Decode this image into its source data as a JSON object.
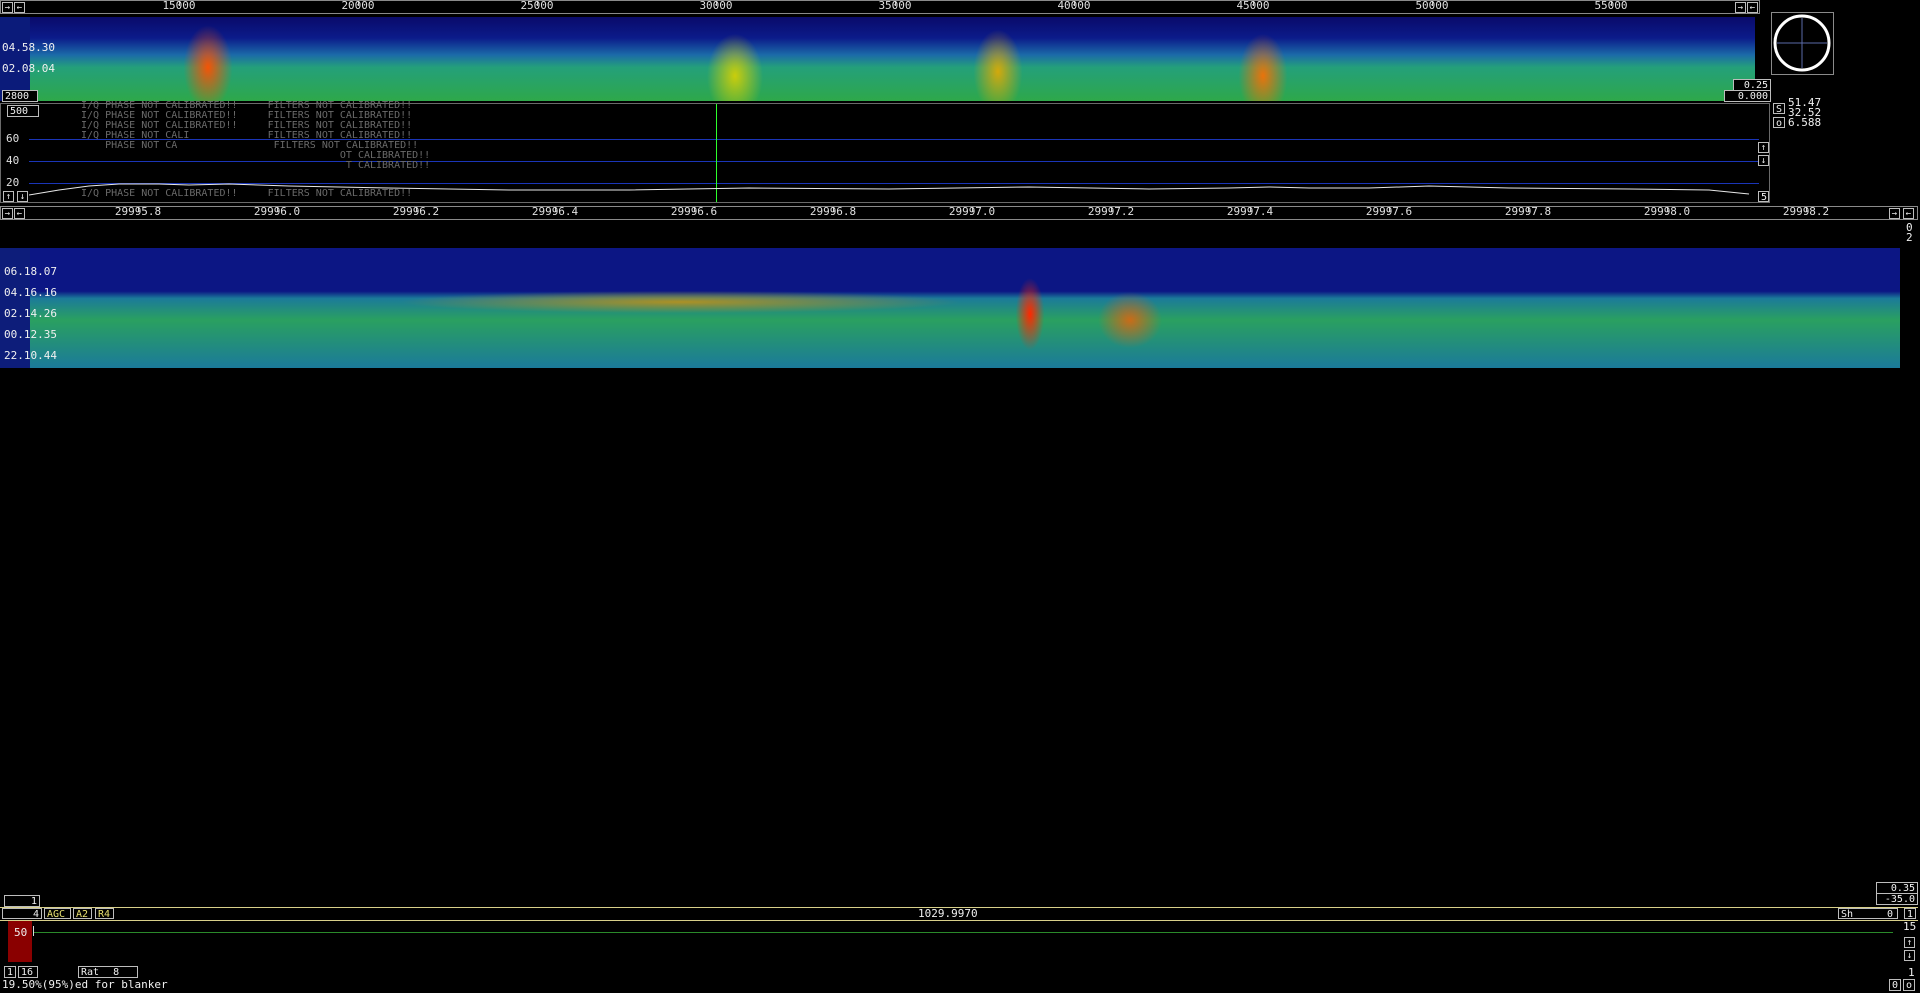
{
  "top_ruler": {
    "ticks": [
      "15000",
      "20000",
      "25000",
      "30000",
      "35000",
      "40000",
      "45000",
      "50000",
      "55000"
    ],
    "left_icon": "arrow-right-icon",
    "right_icons": [
      "arrow-right-icon",
      "arrow-left-icon"
    ]
  },
  "top_waterfall": {
    "times": [
      "04.58.30",
      "02.08.04"
    ],
    "left_value": "2800",
    "right_values": [
      "0.25",
      "0.000"
    ]
  },
  "scope": {
    "s_value": "51.47",
    "mid_value": "32.52",
    "o_value": "6.588",
    "s_label": "S",
    "o_label": "o"
  },
  "spectrum": {
    "top_box": "500",
    "levels": [
      "60",
      "40",
      "20"
    ],
    "right_box": "5",
    "messages": [
      "I/Q PHASE NOT CALIBRATED!!     FILTERS NOT CALIBRATED!!",
      "I/Q PHASE NOT CALIBRATED!!     FILTERS NOT CALIBRATED!!",
      "I/Q PHASE NOT CALIBRATED!!     FILTERS NOT CALIBRATED!!",
      "I/Q PHASE NOT CALI             FILTERS NOT CALIBRATED!!",
      "    PHASE NOT CA                FILTERS NOT CALIBRATED!!",
      "                                           OT CALIBRATED!!",
      "                                            T CALIBRATED!!",
      "I/Q PHASE NOT CALIBRATED!!     FILTERS NOT CALIBRATED!!"
    ]
  },
  "main_ruler": {
    "ticks": [
      "29995.8",
      "29996.0",
      "29996.2",
      "29996.4",
      "29996.6",
      "29996.8",
      "29997.0",
      "29997.2",
      "29997.4",
      "29997.6",
      "29997.8",
      "29998.0",
      "29998.2"
    ],
    "right_values": [
      "0",
      "2"
    ]
  },
  "main_waterfall": {
    "times": [
      "06.18.07",
      "04.16.16",
      "02.14.26",
      "00.12.35",
      "22.10.44"
    ]
  },
  "lower": {
    "left_box": "1",
    "right_values": [
      "0.35",
      "-35.0"
    ]
  },
  "control_bar": {
    "num": "4",
    "agc": "AGC",
    "a2": "A2",
    "r4": "R4",
    "frequency": "1029.9970",
    "sh_label": "Sh",
    "sh_value": "0",
    "right_num": "1"
  },
  "s_meter": {
    "value": "50",
    "right_value": "15"
  },
  "bottom": {
    "box1": "1",
    "box2": "16",
    "rat_label": "Rat",
    "rat_value": "8",
    "status": "19.50%(95%)ed for blanker",
    "right_num": "1",
    "right_boxes": [
      "0",
      "o"
    ]
  },
  "colors": {
    "accent_line": "#d8d08a",
    "spectrum_grid": "#1a35b8",
    "cursor_green": "#2cff2c",
    "smeter_red": "#8a0000"
  }
}
